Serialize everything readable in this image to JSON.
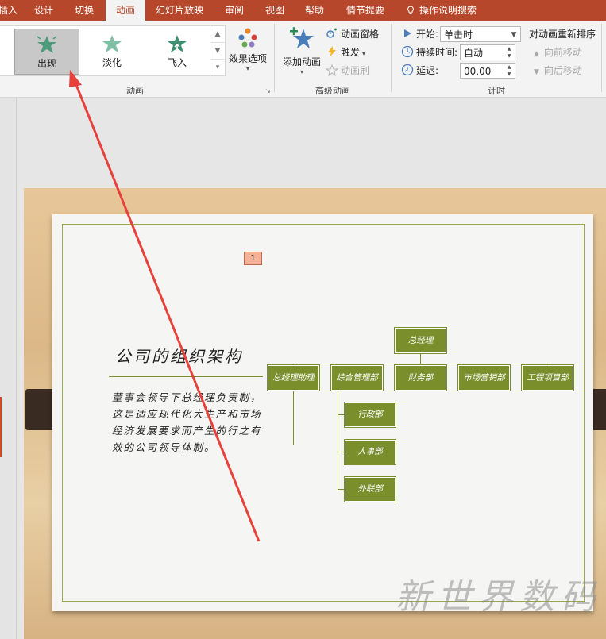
{
  "ribbon_tabs": [
    {
      "label": "插入"
    },
    {
      "label": "设计"
    },
    {
      "label": "切换"
    },
    {
      "label": "动画"
    },
    {
      "label": "幻灯片放映"
    },
    {
      "label": "审阅"
    },
    {
      "label": "视图"
    },
    {
      "label": "帮助"
    },
    {
      "label": "情节提要"
    },
    {
      "label": "操作说明搜索"
    }
  ],
  "tab_visible": {
    "first": "插入"
  },
  "animation_group": {
    "label": "动画",
    "items": [
      {
        "label": "出现",
        "icon": "star-appear-icon"
      },
      {
        "label": "淡化",
        "icon": "star-fade-icon"
      },
      {
        "label": "飞入",
        "icon": "star-fly-in-icon"
      }
    ],
    "effect_options": "效果选项"
  },
  "advanced_group": {
    "label": "高级动画",
    "add_animation": "添加动画",
    "animation_pane": "动画窗格",
    "trigger": "触发",
    "animation_painter": "动画刷"
  },
  "timing_group": {
    "label": "计时",
    "start_label": "开始:",
    "start_value": "单击时",
    "duration_label": "持续时间:",
    "duration_value": "自动",
    "delay_label": "延迟:",
    "delay_value": "00.00",
    "reorder_title": "对动画重新排序",
    "move_earlier": "向前移动",
    "move_later": "向后移动"
  },
  "slide": {
    "animation_tag": "1",
    "title": "公司的组织架构",
    "body": "董事会领导下总经理负责制，这是适应现代化大生产和市场经济发展要求而产生的行之有效的公司领导体制。",
    "org": {
      "top": "总经理",
      "level2": [
        "总经理助理",
        "综合管理部",
        "财务部",
        "市场营销部",
        "工程项目部"
      ],
      "sub": [
        "行政部",
        "人事部",
        "外联部"
      ]
    },
    "watermark": "新世界数码"
  },
  "colors": {
    "accent": "#b7472a",
    "org_box": "#7a8e2b",
    "arrow": "#e8403a"
  }
}
